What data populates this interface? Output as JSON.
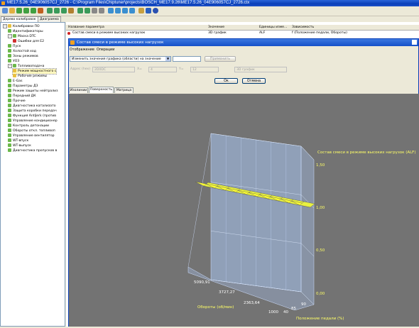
{
  "window": {
    "title": "ME17.5.26_04E906057CJ_2726 - C:\\Program Files\\Chiptuner\\projects\\BOSCH_ME17.9.26\\ME17.5.26_04E906057CJ_2726.ctx"
  },
  "left_tabs": [
    "Дерево калибровок",
    "Диаграмма"
  ],
  "tree": [
    {
      "label": "Калибровки ПО",
      "icon": "folder-icon",
      "expanded": true
    },
    {
      "label": "Идентификаторы",
      "icon": "calibration-icon"
    },
    {
      "label": "Маска DTC",
      "icon": "calibration-icon",
      "expanded": true
    },
    {
      "label": "Ошибки для E2",
      "icon": "error-icon"
    },
    {
      "label": "Пуск",
      "icon": "calibration-icon"
    },
    {
      "label": "Холостой ход",
      "icon": "calibration-icon"
    },
    {
      "label": "Зоны режимов",
      "icon": "calibration-icon"
    },
    {
      "label": "УОЗ",
      "icon": "calibration-icon"
    },
    {
      "label": "Топливоподача",
      "icon": "calibration-icon",
      "expanded": true
    },
    {
      "label": "Режим мощностного с",
      "icon": "folder-icon",
      "selected": true
    },
    {
      "label": "Рабочие режимы",
      "icon": "folder-icon"
    },
    {
      "label": "E-Gas",
      "icon": "calibration-icon"
    },
    {
      "label": "Параметры ДЗ",
      "icon": "calibration-icon"
    },
    {
      "label": "Режим защиты нейтрализ",
      "icon": "calibration-icon"
    },
    {
      "label": "Передний ДК",
      "icon": "calibration-icon"
    },
    {
      "label": "Прочие",
      "icon": "calibration-icon"
    },
    {
      "label": "Диагностика катализато",
      "icon": "calibration-icon"
    },
    {
      "label": "Защита коробки передач",
      "icon": "calibration-icon"
    },
    {
      "label": "Функция AntiJerk (против",
      "icon": "calibration-icon"
    },
    {
      "label": "Управление кондиционер",
      "icon": "calibration-icon"
    },
    {
      "label": "Контроль детонации",
      "icon": "calibration-icon"
    },
    {
      "label": "Обороты откл. топливоп",
      "icon": "calibration-icon"
    },
    {
      "label": "Управление вентилятор",
      "icon": "calibration-icon"
    },
    {
      "label": "WT-впуск",
      "icon": "calibration-icon"
    },
    {
      "label": "WT-выпуск",
      "icon": "calibration-icon"
    },
    {
      "label": "Диагностика пропусков в",
      "icon": "calibration-icon"
    }
  ],
  "param_table": {
    "headers": [
      "Название параметра",
      "Значение",
      "Единицы изме...",
      "Зависимость"
    ],
    "row": [
      "Состав смеси в режиме высоких нагрузок",
      "3D график",
      "ALF",
      "f (Положение педали, Обороты)"
    ]
  },
  "dialog": {
    "title": "Состав смеси в режиме высоких нагрузок",
    "menu": [
      "Отображение",
      "Операции"
    ],
    "mode_select": "Изменить значения графика (области) на значение",
    "value_input": "",
    "apply_label": "Применить",
    "axis_select": "Адрес (hex)",
    "addr_value": "2D0DC",
    "from_label": "X=",
    "from_value": "4",
    "to_label": "Y=",
    "to_value": "12",
    "graph_select": "3D график",
    "ok_label": "Ок",
    "cancel_label": "Отмена",
    "tabs": [
      "Изолинии",
      "Поверхность",
      "Матрица"
    ],
    "active_tab": 1
  },
  "chart_data": {
    "type": "surface",
    "title": "Состав смеси в режиме высоких нагрузок (ALF)",
    "xlabel": "Обороты (об/мин)",
    "ylabel": "Положение педали (%)",
    "zlabel": "Состав смеси в режиме высоких нагрузок (ALF)",
    "z_ticks": [
      "1,50",
      "1,00",
      "0,50",
      "0,00"
    ],
    "x_ticks": [
      "5090,91",
      "3727,27",
      "2363,64",
      "1000"
    ],
    "y_ticks": [
      "40",
      "85",
      "90"
    ],
    "zlim": [
      0,
      1.5
    ],
    "surface_value_approx": 1.0,
    "colors": {
      "surface": "#ffff33",
      "walls": "#a8c4f0",
      "background": "#737373",
      "text": "#ffff66"
    }
  }
}
